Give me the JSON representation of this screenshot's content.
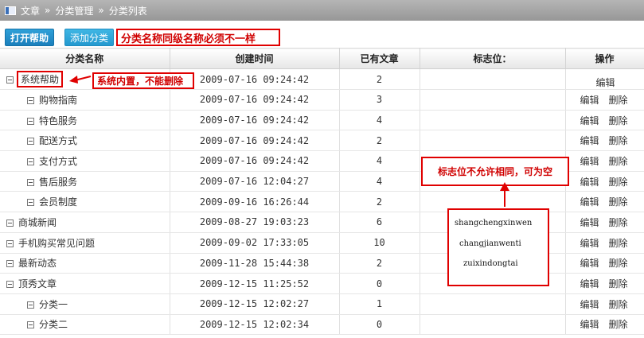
{
  "breadcrumb": {
    "items": [
      "文章",
      "分类管理",
      "分类列表"
    ],
    "separator": "»"
  },
  "toolbar": {
    "help_label": "打开帮助",
    "add_label": "添加分类"
  },
  "notes": {
    "same_level_name": "分类名称同级名称必须不一样",
    "builtin": "系统内置，不能删除",
    "flag_unique": "标志位不允许相同，可为空"
  },
  "table": {
    "headers": {
      "name": "分类名称",
      "created": "创建时间",
      "count": "已有文章",
      "flag": "标志位：",
      "ops": "操作"
    },
    "ops": {
      "edit": "编辑",
      "delete": "删除"
    },
    "rows": [
      {
        "name": "系统帮助",
        "created": "2009-07-16 09:24:42",
        "count": "2",
        "child": false,
        "builtin": true
      },
      {
        "name": "购物指南",
        "created": "2009-07-16 09:24:42",
        "count": "3",
        "child": true
      },
      {
        "name": "特色服务",
        "created": "2009-07-16 09:24:42",
        "count": "4",
        "child": true
      },
      {
        "name": "配送方式",
        "created": "2009-07-16 09:24:42",
        "count": "2",
        "child": true
      },
      {
        "name": "支付方式",
        "created": "2009-07-16 09:24:42",
        "count": "4",
        "child": true
      },
      {
        "name": "售后服务",
        "created": "2009-07-16 12:04:27",
        "count": "4",
        "child": true
      },
      {
        "name": "会员制度",
        "created": "2009-09-16 16:26:44",
        "count": "2",
        "child": true
      },
      {
        "name": "商城新闻",
        "created": "2009-08-27 19:03:23",
        "count": "6",
        "child": false
      },
      {
        "name": "手机购买常见问题",
        "created": "2009-09-02 17:33:05",
        "count": "10",
        "child": false
      },
      {
        "name": "最新动态",
        "created": "2009-11-28 15:44:38",
        "count": "2",
        "child": false
      },
      {
        "name": "顶秀文章",
        "created": "2009-12-15 11:25:52",
        "count": "0",
        "child": false
      },
      {
        "name": "分类一",
        "created": "2009-12-15 12:02:27",
        "count": "1",
        "child": true
      },
      {
        "name": "分类二",
        "created": "2009-12-15 12:02:34",
        "count": "0",
        "child": true
      }
    ]
  },
  "flags": [
    "shangchengxinwen",
    "changjianwenti",
    "zuixindongtai"
  ],
  "colors": {
    "annotation_red": "#e00000",
    "button_blue": "#1b7fbc"
  }
}
